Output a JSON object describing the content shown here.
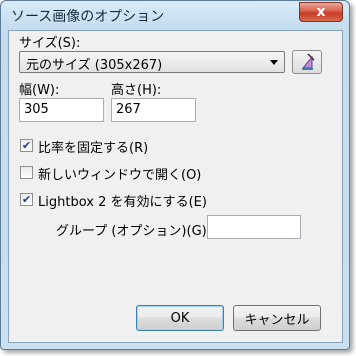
{
  "window": {
    "title": "ソース画像のオプション",
    "close_glyph": "x"
  },
  "size": {
    "label": "サイズ(S):",
    "selected": "元のサイズ (305x267)",
    "icon": "ruler-triangle-icon"
  },
  "width": {
    "label": "幅(W):",
    "value": "305"
  },
  "height": {
    "label": "高さ(H):",
    "value": "267"
  },
  "options": [
    {
      "label": "比率を固定する(R)",
      "checked": true
    },
    {
      "label": "新しいウィンドウで開く(O)",
      "checked": false
    },
    {
      "label": "Lightbox 2 を有効にする(E)",
      "checked": true
    }
  ],
  "group": {
    "label": "グループ (オプション)(G):",
    "value": ""
  },
  "buttons": {
    "ok": "OK",
    "cancel": "キャンセル"
  },
  "colors": {
    "frame": "#c8e0f1",
    "close": "#c83a24",
    "check": "#1e3f8a"
  }
}
